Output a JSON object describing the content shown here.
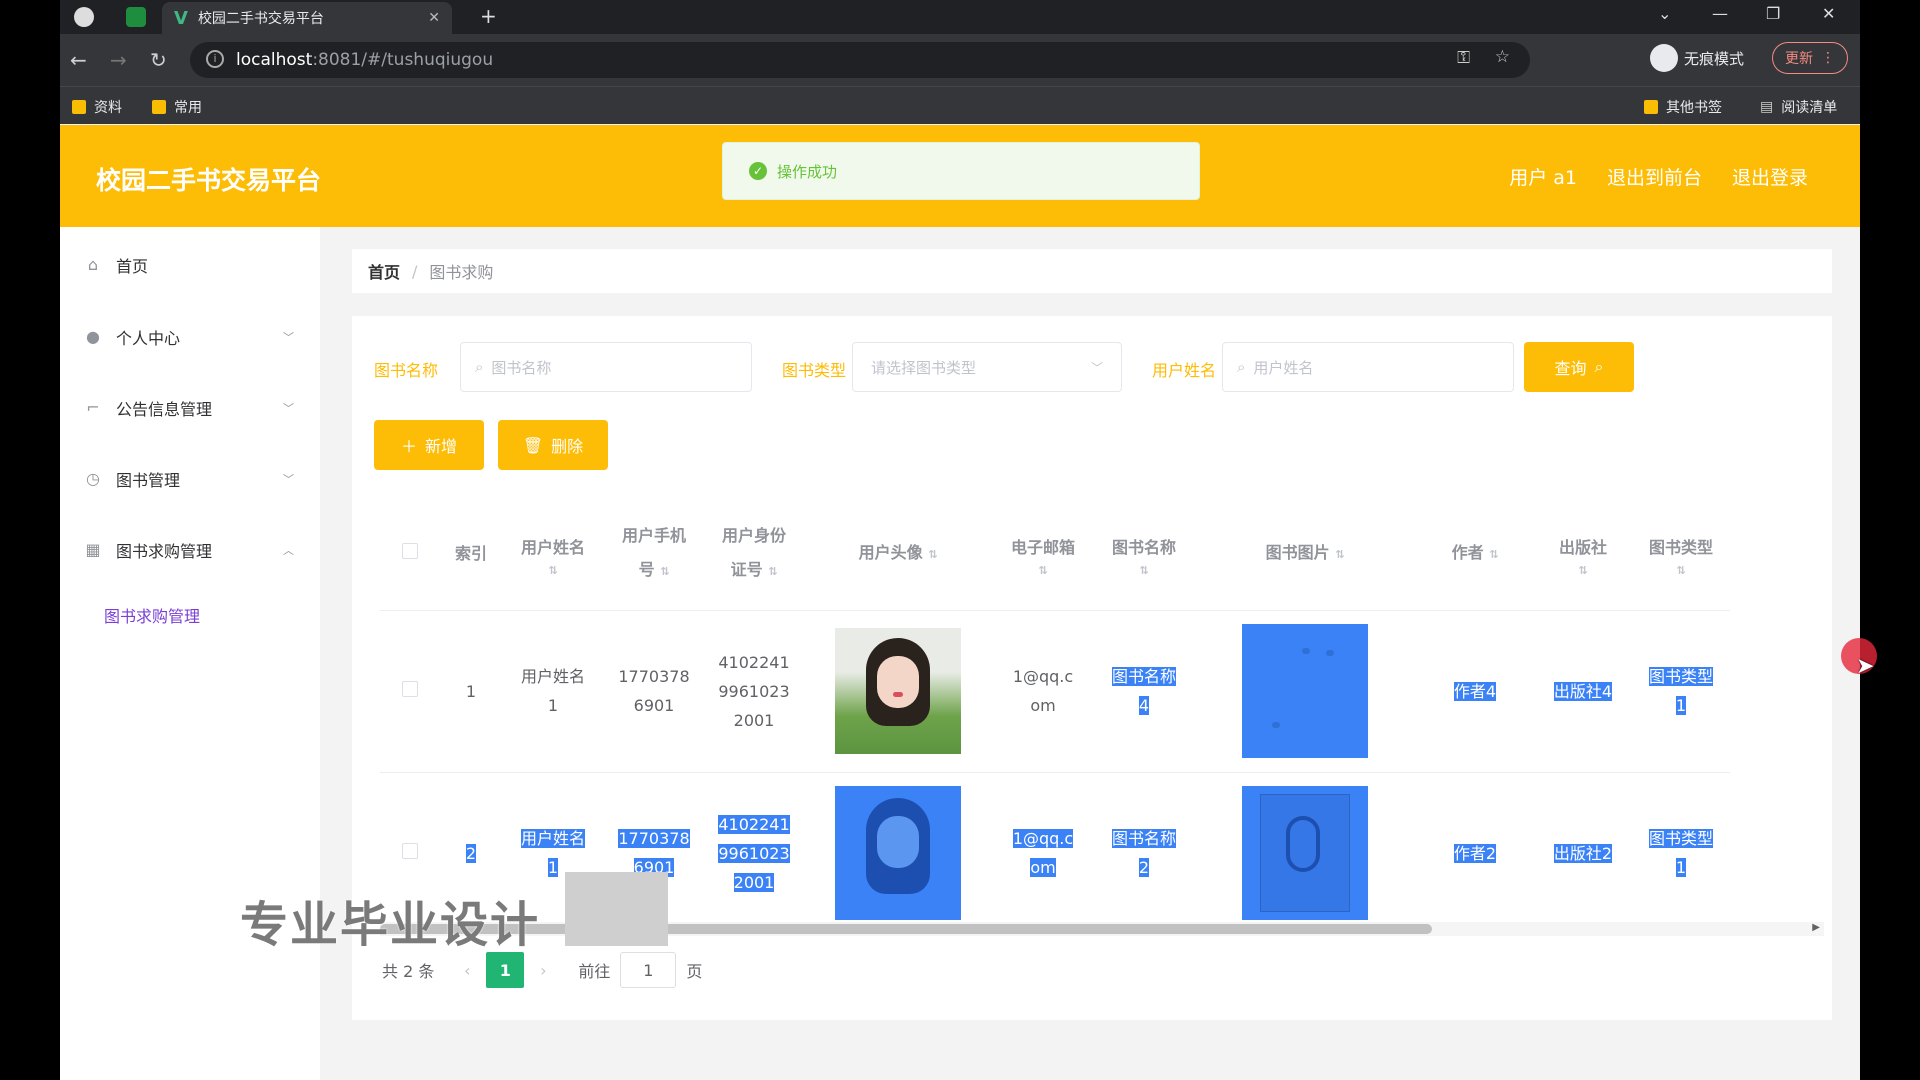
{
  "browser": {
    "tab_title": "校园二手书交易平台",
    "url_host": "localhost",
    "url_path": ":8081/#/tushuqiugou",
    "incognito_label": "无痕模式",
    "update_label": "更新",
    "bookmarks": [
      "资料",
      "常用"
    ],
    "bookmarks_right": [
      "其他书签",
      "阅读清单"
    ]
  },
  "header": {
    "title": "校园二手书交易平台",
    "toast": "操作成功",
    "links": [
      "用户 a1",
      "退出到前台",
      "退出登录"
    ],
    "bg_color": "#fdbc06"
  },
  "sidebar": {
    "items": [
      {
        "label": "首页",
        "icon": "home-icon"
      },
      {
        "label": "个人中心",
        "icon": "user-icon"
      },
      {
        "label": "公告信息管理",
        "icon": "crop-icon"
      },
      {
        "label": "图书管理",
        "icon": "clock-icon"
      },
      {
        "label": "图书求购管理",
        "icon": "film-icon"
      }
    ],
    "subitem": "图书求购管理"
  },
  "breadcrumb": {
    "home": "首页",
    "current": "图书求购"
  },
  "filters": {
    "book_name_label": "图书名称",
    "book_name_placeholder": "图书名称",
    "book_type_label": "图书类型",
    "book_type_placeholder": "请选择图书类型",
    "user_name_label": "用户姓名",
    "user_name_placeholder": "用户姓名",
    "query_button": "查询"
  },
  "actions": {
    "add": "新增",
    "delete": "删除"
  },
  "table": {
    "headers": [
      "索引",
      "用户姓名",
      "用户手机号",
      "用户身份证号",
      "用户头像",
      "电子邮箱",
      "图书名称",
      "图书图片",
      "作者",
      "出版社",
      "图书类型"
    ],
    "header_lines": {
      "name": [
        "用户姓名"
      ],
      "phone": [
        "用户手机",
        "号"
      ],
      "id": [
        "用户身份",
        "证号"
      ],
      "email": [
        "电子邮箱"
      ],
      "book": [
        "图书名称"
      ]
    },
    "rows": [
      {
        "index": "1",
        "name": [
          "用户姓名",
          "1"
        ],
        "phone": [
          "1770378",
          "6901"
        ],
        "id": [
          "4102241",
          "9961023",
          "2001"
        ],
        "email": [
          "1@qq.c",
          "om"
        ],
        "book": [
          "图书名称",
          "4"
        ],
        "author": "作者4",
        "publisher": "出版社4",
        "type": [
          "图书类型",
          "1"
        ]
      },
      {
        "index": "2",
        "name": [
          "用户姓名",
          "1"
        ],
        "phone": [
          "1770378",
          "6901"
        ],
        "id": [
          "4102241",
          "9961023",
          "2001"
        ],
        "email": [
          "1@qq.c",
          "om"
        ],
        "book": [
          "图书名称",
          "2"
        ],
        "author": "作者2",
        "publisher": "出版社2",
        "type": [
          "图书类型",
          "1"
        ]
      }
    ]
  },
  "pager": {
    "total": "共 2 条",
    "current": "1",
    "goto_label": "前往",
    "goto_value": "1",
    "page_suffix": "页"
  },
  "watermark": "专业毕业设计"
}
